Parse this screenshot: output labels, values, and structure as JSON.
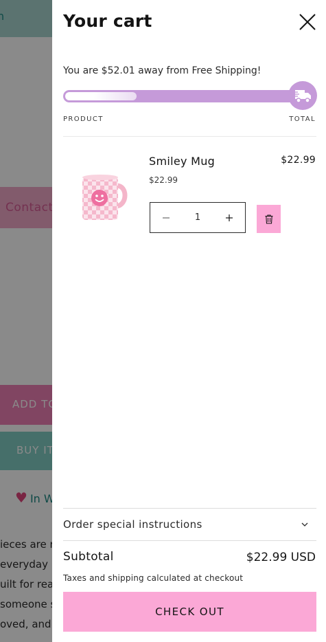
{
  "background": {
    "top_link": "n",
    "contact_label": "Contact",
    "add_to_cart_label": "ADD TO",
    "buy_it_label": "BUY IT",
    "wishlist_label": "In W",
    "description_lines": [
      "ieces are r",
      " everyday",
      "uilt for rea",
      "someone s",
      "oved, and s"
    ]
  },
  "cart": {
    "title": "Your cart",
    "shipping_message": "You are $52.01 away from Free Shipping!",
    "shipping_progress_percent": 30,
    "label_product": "PRODUCT",
    "label_total": "TOTAL",
    "items": [
      {
        "name": "Smiley Mug",
        "unit_price": "$22.99",
        "line_total": "$22.99",
        "quantity": "1"
      }
    ],
    "instructions_label": "Order special instructions",
    "subtotal_label": "Subtotal",
    "subtotal_value": "$22.99 USD",
    "tax_note": "Taxes and shipping calculated at checkout",
    "checkout_label": "CHECK OUT"
  },
  "colors": {
    "accent_pink": "#fba8d6",
    "progress_purple": "#c59ad9",
    "teal": "#82cec4"
  }
}
